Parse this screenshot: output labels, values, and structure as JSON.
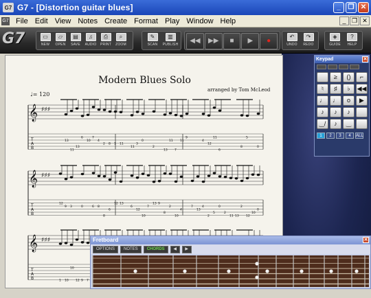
{
  "window": {
    "app_icon": "G7",
    "title": "G7 - [Distortion guitar blues]",
    "minimize": "_",
    "maximize": "❐",
    "close": "✕"
  },
  "menu": {
    "items": [
      "File",
      "Edit",
      "View",
      "Notes",
      "Create",
      "Format",
      "Play",
      "Window",
      "Help"
    ]
  },
  "toolbar": {
    "logo": "G7",
    "file_buttons": [
      {
        "label": "NEW",
        "icon": "new-icon",
        "glyph": "▭"
      },
      {
        "label": "OPEN",
        "icon": "open-icon",
        "glyph": "▱"
      },
      {
        "label": "SAVE",
        "icon": "save-icon",
        "glyph": "▤"
      },
      {
        "label": "AUDIO",
        "icon": "audio-icon",
        "glyph": "♫"
      },
      {
        "label": "PRINT",
        "icon": "print-icon",
        "glyph": "⎙"
      },
      {
        "label": "ZOOM",
        "icon": "zoom-icon",
        "glyph": "⌕"
      }
    ],
    "scan_buttons": [
      {
        "label": "SCAN",
        "icon": "scan-icon",
        "glyph": "✎"
      },
      {
        "label": "PUBLISH",
        "icon": "publish-icon",
        "glyph": "▥"
      }
    ],
    "transport": [
      {
        "name": "rewind",
        "glyph": "◀◀"
      },
      {
        "name": "fast-forward",
        "glyph": "▶▶"
      },
      {
        "name": "stop",
        "glyph": "■"
      },
      {
        "name": "play",
        "glyph": "▶"
      },
      {
        "name": "record",
        "glyph": "●"
      }
    ],
    "edit_buttons": [
      {
        "label": "UNDO",
        "icon": "undo-icon",
        "glyph": "↶"
      },
      {
        "label": "REDO",
        "icon": "redo-icon",
        "glyph": "↷"
      }
    ],
    "help_buttons": [
      {
        "label": "GUIDE",
        "icon": "guide-icon",
        "glyph": "◈"
      },
      {
        "label": "HELP",
        "icon": "help-icon",
        "glyph": "?"
      }
    ]
  },
  "score": {
    "title": "Modern Blues Solo",
    "arranger": "arranged by Tom McLeod",
    "tempo": "♩= 120"
  },
  "keypad": {
    "title": "Keypad",
    "keys": [
      "",
      "≥",
      "()",
      "⌐",
      "♮",
      "♯",
      "♭",
      "◀◀",
      "♩",
      "♩",
      "o",
      "▶",
      "♪",
      "♪",
      "♪",
      "",
      "‿/",
      "♪",
      "‿",
      ""
    ],
    "voices": [
      "1",
      "2",
      "3",
      "4",
      "ALL"
    ],
    "active_voice": "1"
  },
  "fretboard": {
    "title": "Fretboard",
    "tabs": [
      "OPTIONS",
      "NOTES",
      "CHORDS"
    ],
    "active_tab": "CHORDS",
    "prev": "◀",
    "next": "▶"
  },
  "colors": {
    "title_bar": "#1a46b8",
    "fretboard_wood": "#4a2a1a",
    "chords_active": "#6fd84a"
  }
}
